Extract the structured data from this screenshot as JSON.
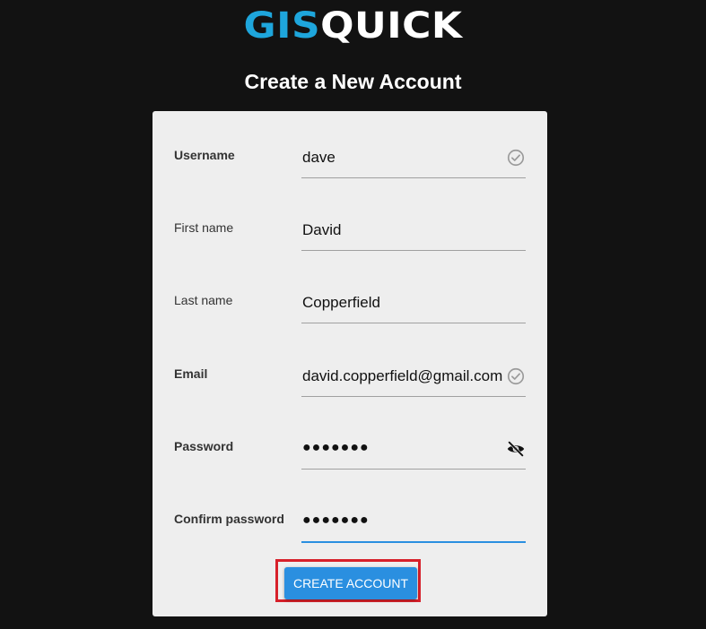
{
  "logo": {
    "part1": "GIS",
    "part2": "QUICK"
  },
  "title": "Create a New Account",
  "fields": {
    "username": {
      "label": "Username",
      "value": "dave",
      "icon": "check-circle-icon"
    },
    "first_name": {
      "label": "First name",
      "value": "David"
    },
    "last_name": {
      "label": "Last name",
      "value": "Copperfield"
    },
    "email": {
      "label": "Email",
      "value": "david.copperfield@gmail.com",
      "icon": "check-circle-icon"
    },
    "password": {
      "label": "Password",
      "value": "●●●●●●●",
      "icon": "eye-off-icon"
    },
    "confirm_password": {
      "label": "Confirm password",
      "value": "●●●●●●●"
    }
  },
  "create_button": {
    "label": "CREATE ACCOUNT"
  },
  "colors": {
    "background": "#121212",
    "accent": "#2a8fe0",
    "logo_blue": "#1ea6dc",
    "highlight_frame": "#d7202a"
  }
}
